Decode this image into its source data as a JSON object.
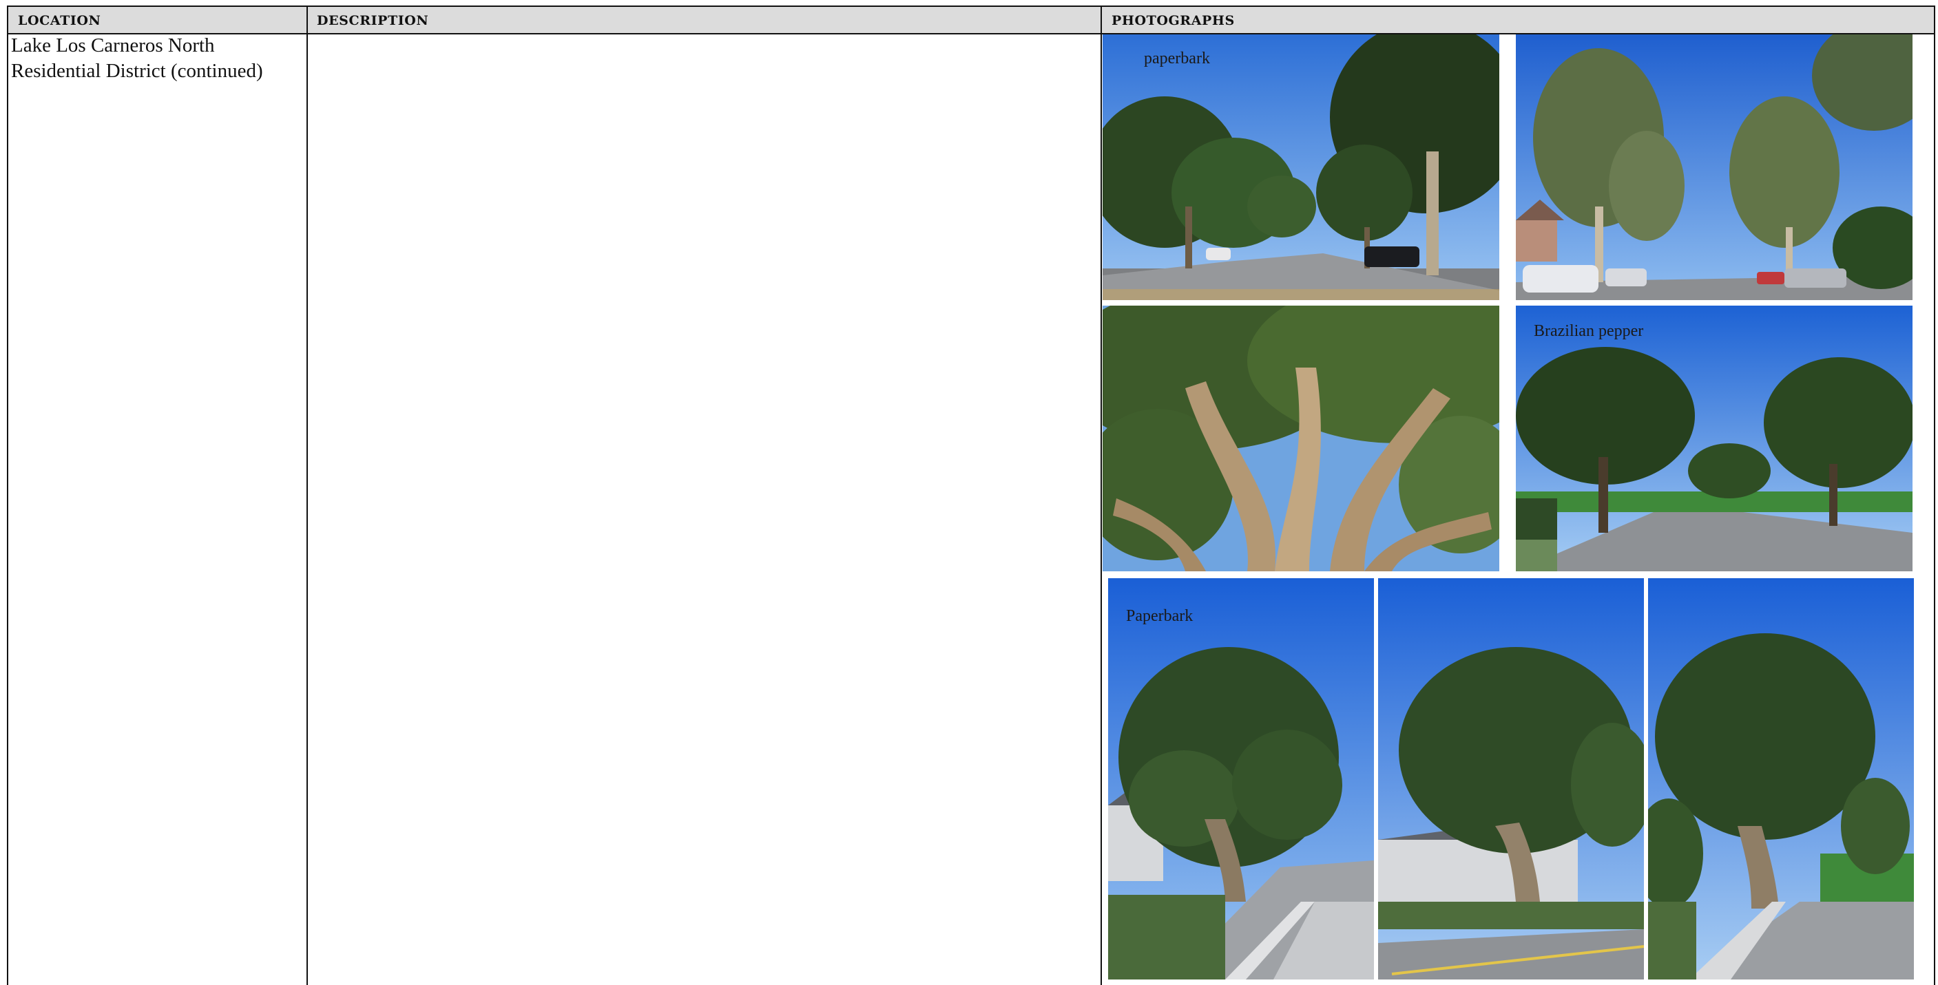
{
  "table": {
    "headers": {
      "location": "LOCATION",
      "description": "DESCRIPTION",
      "photographs": "PHOTOGRAPHS"
    },
    "row": {
      "location": "Lake Los Carneros North Residential District (continued)",
      "description": ""
    }
  },
  "photos": [
    {
      "caption": "paperbark"
    },
    {
      "caption": ""
    },
    {
      "caption": ""
    },
    {
      "caption": "Brazilian pepper"
    },
    {
      "caption": "Paperbark"
    },
    {
      "caption": ""
    },
    {
      "caption": ""
    }
  ],
  "colors": {
    "header_bg": "#dcdcdc",
    "border": "#111111",
    "sky": "#3f7fe0",
    "foliage": "#2f4a26",
    "road": "#8f9194"
  }
}
